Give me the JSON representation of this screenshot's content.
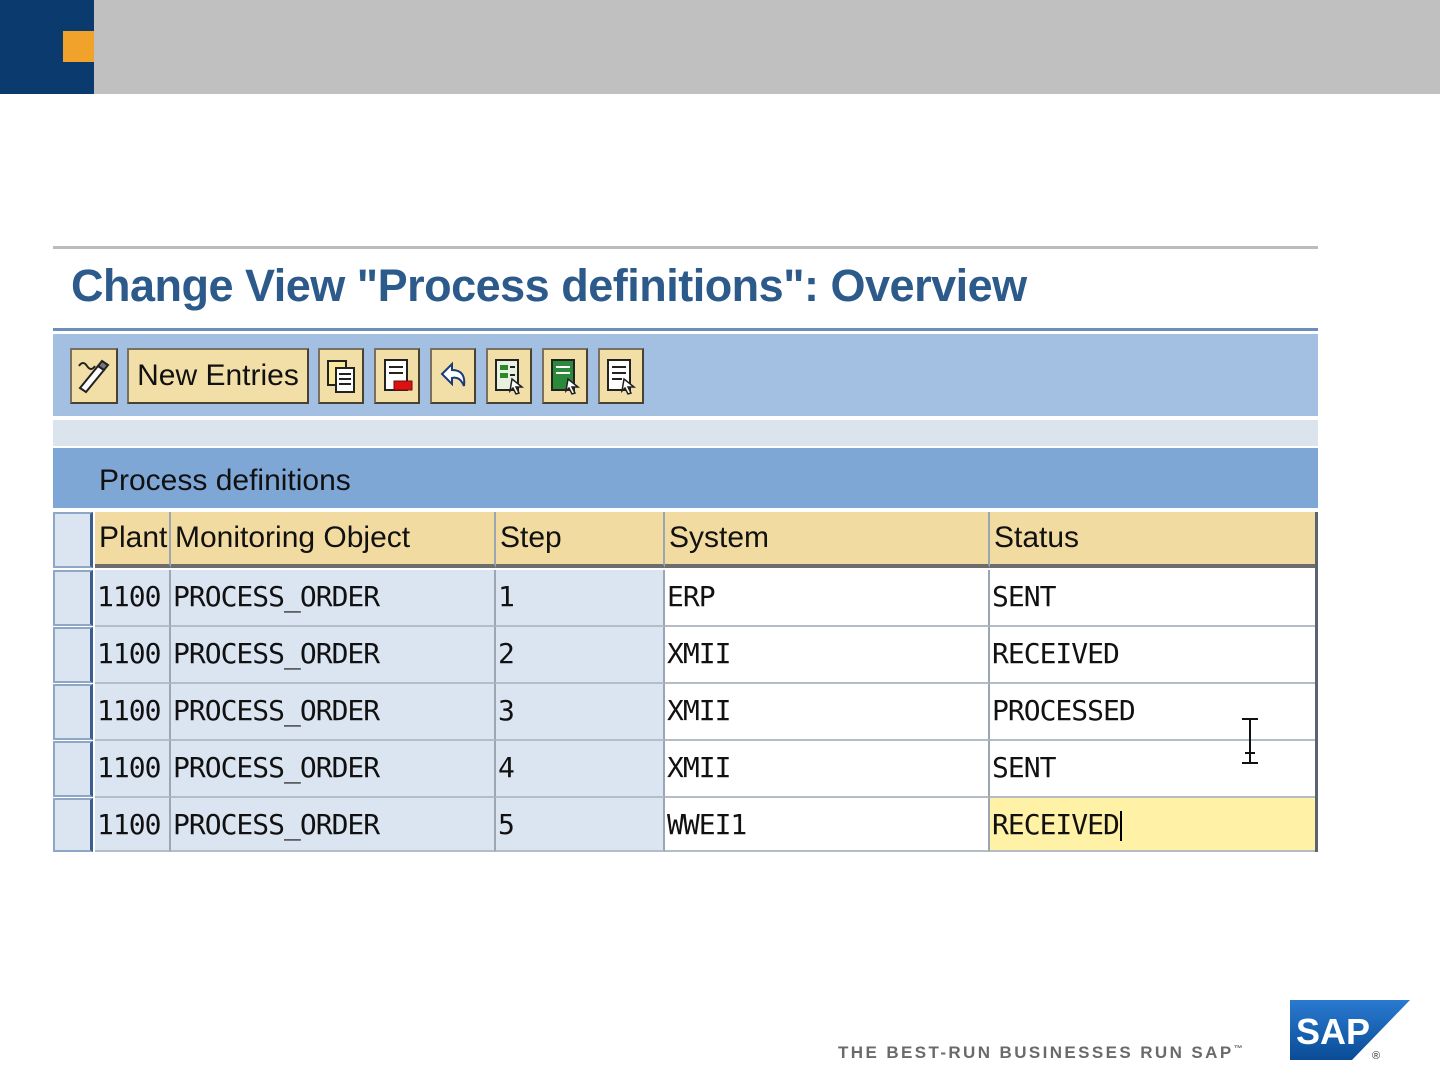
{
  "window": {
    "title": "Change View \"Process definitions\": Overview"
  },
  "toolbar": {
    "new_entries_label": "New Entries",
    "icons": [
      "display-change-icon",
      "copy-icon",
      "delete-icon",
      "undo-icon",
      "select-all-icon",
      "select-block-icon",
      "deselect-all-icon"
    ]
  },
  "section": {
    "title": "Process definitions"
  },
  "table": {
    "columns": [
      "Plant",
      "Monitoring Object",
      "Step",
      "System",
      "Status"
    ],
    "rows": [
      {
        "plant": "1100",
        "object": "PROCESS_ORDER",
        "step": "1",
        "system": "ERP",
        "status": "SENT"
      },
      {
        "plant": "1100",
        "object": "PROCESS_ORDER",
        "step": "2",
        "system": "XMII",
        "status": "RECEIVED"
      },
      {
        "plant": "1100",
        "object": "PROCESS_ORDER",
        "step": "3",
        "system": "XMII",
        "status": "PROCESSED"
      },
      {
        "plant": "1100",
        "object": "PROCESS_ORDER",
        "step": "4",
        "system": "XMII",
        "status": "SENT"
      },
      {
        "plant": "1100",
        "object": "PROCESS_ORDER",
        "step": "5",
        "system": "WWEI1",
        "status": "RECEIVED"
      }
    ]
  },
  "footer": {
    "tagline": "THE BEST-RUN BUSINESSES RUN SAP",
    "tagline_mark": "™",
    "logo_text": "SAP",
    "logo_mark": "®"
  },
  "colors": {
    "header_gray": "#c0c0c0",
    "header_navy": "#0a3a6e",
    "header_accent": "#f0a22a",
    "toolbar_blue": "#a3c0e3",
    "section_blue": "#7fa7d6",
    "column_header": "#f2dba0",
    "key_cell": "#dbe5f2",
    "focus_cell": "#fff2a6",
    "logo_blue": "#0a5aa8"
  }
}
